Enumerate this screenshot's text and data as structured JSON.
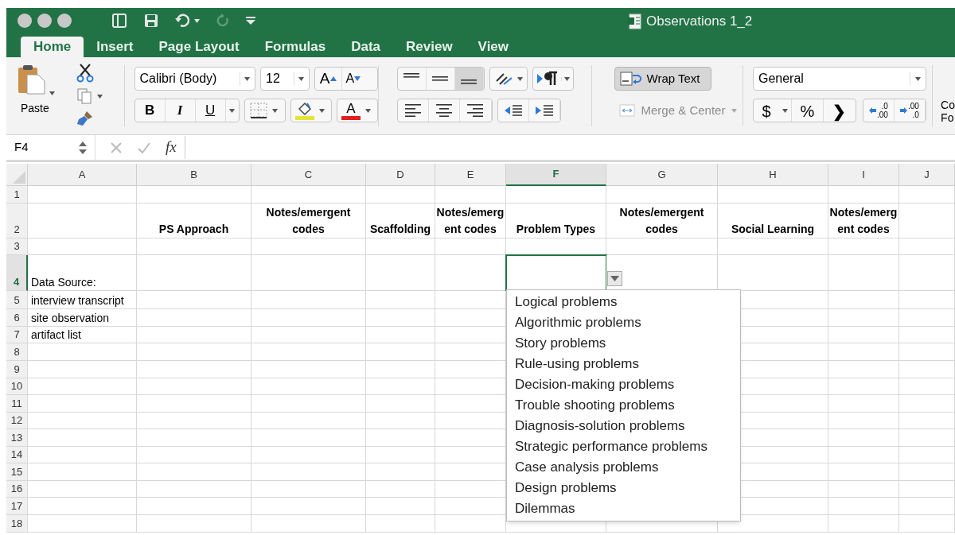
{
  "window": {
    "title": "Observations 1_2"
  },
  "tabs": [
    {
      "label": "Home",
      "selected": true
    },
    {
      "label": "Insert",
      "selected": false
    },
    {
      "label": "Page Layout",
      "selected": false
    },
    {
      "label": "Formulas",
      "selected": false
    },
    {
      "label": "Data",
      "selected": false
    },
    {
      "label": "Review",
      "selected": false
    },
    {
      "label": "View",
      "selected": false
    }
  ],
  "ribbon": {
    "paste_label": "Paste",
    "font": "Calibri (Body)",
    "font_size": "12",
    "grow_label": "A",
    "shrink_label": "A",
    "style_buttons": [
      "B",
      "I",
      "U"
    ],
    "font_color_label": "A",
    "vertical_align": [
      {
        "selected": false
      },
      {
        "selected": false
      },
      {
        "selected": true
      }
    ],
    "wrap_text": {
      "label": "Wrap Text",
      "on": true
    },
    "merge_center": {
      "label": "Merge & Center",
      "disabled": true
    },
    "number_format": "General",
    "number_buttons": [
      "$",
      "%",
      "❯"
    ],
    "decimal_buttons": [
      {
        "top": ".0",
        "bottom": ".00"
      },
      {
        "top": ".00",
        "bottom": ".0"
      }
    ],
    "cut_off_group": [
      "Co",
      "Fo"
    ]
  },
  "formula_bar": {
    "name_box": "F4",
    "fx": "fx"
  },
  "columns": [
    {
      "letter": "A",
      "selected": false
    },
    {
      "letter": "B",
      "selected": false
    },
    {
      "letter": "C",
      "selected": false
    },
    {
      "letter": "D",
      "selected": false
    },
    {
      "letter": "E",
      "selected": false
    },
    {
      "letter": "F",
      "selected": true
    },
    {
      "letter": "G",
      "selected": false
    },
    {
      "letter": "H",
      "selected": false
    },
    {
      "letter": "I",
      "selected": false
    },
    {
      "letter": "J",
      "selected": false
    }
  ],
  "rows": [
    {
      "number": "1",
      "selected": false,
      "kind": "empty"
    },
    {
      "number": "2",
      "selected": false,
      "kind": "header",
      "headings": [
        "PS Approach",
        "Notes/emergent codes",
        "Scaffolding",
        "Notes/emergent codes",
        "Problem Types",
        "Notes/emergent codes",
        "Social Learning",
        "Notes/emergent codes"
      ]
    },
    {
      "number": "3",
      "selected": false,
      "kind": "empty"
    },
    {
      "number": "4",
      "selected": true,
      "kind": "label",
      "text": "Data Source:"
    },
    {
      "number": "5",
      "selected": false,
      "kind": "label",
      "text": "interview transcript"
    },
    {
      "number": "6",
      "selected": false,
      "kind": "label",
      "text": "site observation"
    },
    {
      "number": "7",
      "selected": false,
      "kind": "label",
      "text": "artifact list"
    },
    {
      "number": "8",
      "selected": false,
      "kind": "empty"
    },
    {
      "number": "9",
      "selected": false,
      "kind": "empty"
    },
    {
      "number": "10",
      "selected": false,
      "kind": "empty"
    },
    {
      "number": "11",
      "selected": false,
      "kind": "empty"
    },
    {
      "number": "12",
      "selected": false,
      "kind": "empty"
    },
    {
      "number": "13",
      "selected": false,
      "kind": "empty"
    },
    {
      "number": "14",
      "selected": false,
      "kind": "empty"
    },
    {
      "number": "15",
      "selected": false,
      "kind": "empty"
    },
    {
      "number": "16",
      "selected": false,
      "kind": "empty"
    },
    {
      "number": "17",
      "selected": false,
      "kind": "empty"
    },
    {
      "number": "18",
      "selected": false,
      "kind": "empty"
    }
  ],
  "validation_list": {
    "items": [
      "Logical problems",
      "Algorithmic problems",
      "Story problems",
      "Rule-using problems",
      "Decision-making problems",
      "Trouble shooting problems",
      "Diagnosis-solution problems",
      "Strategic performance problems",
      "Case analysis problems",
      "Design problems",
      "Dilemmas"
    ]
  }
}
